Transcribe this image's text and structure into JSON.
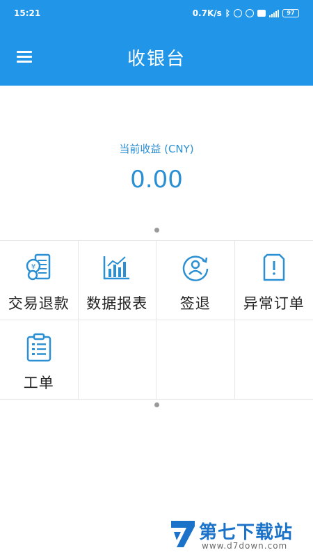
{
  "status_bar": {
    "time": "15:21",
    "net_speed": "0.7K/s",
    "battery": "97"
  },
  "header": {
    "title": "收银台",
    "menu_icon": "menu-icon"
  },
  "earnings": {
    "label": "当前收益 (CNY)",
    "value": "0.00"
  },
  "menu_items": [
    {
      "label": "交易退款",
      "icon": "transaction-refund-icon"
    },
    {
      "label": "数据报表",
      "icon": "data-report-icon"
    },
    {
      "label": "签退",
      "icon": "sign-out-icon"
    },
    {
      "label": "异常订单",
      "icon": "abnormal-order-icon"
    },
    {
      "label": "工单",
      "icon": "work-order-icon"
    }
  ],
  "watermark": {
    "brand": "第七下载站",
    "url": "www.d7down.com"
  },
  "colors": {
    "primary": "#2196e8",
    "accent_text": "#2a8fd3",
    "icon": "#2a8fd3"
  }
}
